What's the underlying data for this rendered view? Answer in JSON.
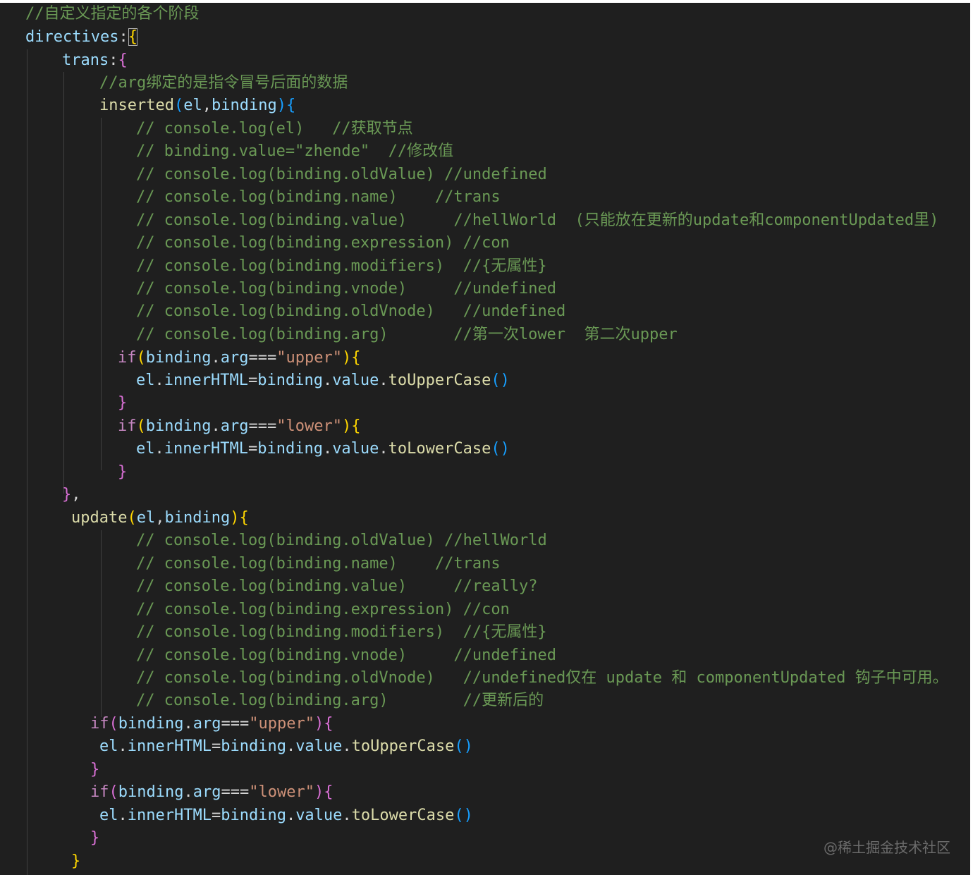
{
  "editor": {
    "lines": [
      [
        {
          "t": "//自定义指定的各个阶段",
          "c": "comment"
        }
      ],
      [
        {
          "t": "directives",
          "c": "prop"
        },
        {
          "t": ":",
          "c": "plain"
        },
        {
          "t": "{",
          "c": "p1",
          "box": true
        }
      ],
      [
        {
          "t": "trans",
          "c": "prop"
        },
        {
          "t": ":",
          "c": "plain"
        },
        {
          "t": "{",
          "c": "p2"
        }
      ],
      [
        {
          "t": "//arg绑定的是指令冒号后面的数据",
          "c": "comment"
        }
      ],
      [
        {
          "t": "inserted",
          "c": "fn"
        },
        {
          "t": "(",
          "c": "p3"
        },
        {
          "t": "el",
          "c": "prop"
        },
        {
          "t": ",",
          "c": "plain"
        },
        {
          "t": "binding",
          "c": "prop"
        },
        {
          "t": ")",
          "c": "p3"
        },
        {
          "t": "{",
          "c": "p3"
        }
      ],
      [
        {
          "t": "// console.log(el)   //获取节点",
          "c": "comment"
        }
      ],
      [
        {
          "t": "// binding.value=\"zhende\"  //修改值",
          "c": "comment"
        }
      ],
      [
        {
          "t": "// console.log(binding.oldValue) //undefined",
          "c": "comment"
        }
      ],
      [
        {
          "t": "// console.log(binding.name)    //trans",
          "c": "comment"
        }
      ],
      [
        {
          "t": "// console.log(binding.value)     //hellWorld  (只能放在更新的update和componentUpdated里)",
          "c": "comment"
        }
      ],
      [
        {
          "t": "// console.log(binding.expression) //con",
          "c": "comment"
        }
      ],
      [
        {
          "t": "// console.log(binding.modifiers)  //{无属性}",
          "c": "comment"
        }
      ],
      [
        {
          "t": "// console.log(binding.vnode)     //undefined",
          "c": "comment"
        }
      ],
      [
        {
          "t": "// console.log(binding.oldVnode)   //undefined",
          "c": "comment"
        }
      ],
      [
        {
          "t": "// console.log(binding.arg)       //第一次lower  第二次upper",
          "c": "comment"
        }
      ],
      [
        {
          "t": "if",
          "c": "kw"
        },
        {
          "t": "(",
          "c": "p1"
        },
        {
          "t": "binding",
          "c": "prop"
        },
        {
          "t": ".",
          "c": "plain"
        },
        {
          "t": "arg",
          "c": "prop"
        },
        {
          "t": "===",
          "c": "plain"
        },
        {
          "t": "\"upper\"",
          "c": "str"
        },
        {
          "t": ")",
          "c": "p1"
        },
        {
          "t": "{",
          "c": "p1"
        }
      ],
      [
        {
          "t": "el",
          "c": "prop"
        },
        {
          "t": ".",
          "c": "plain"
        },
        {
          "t": "innerHTML",
          "c": "prop"
        },
        {
          "t": "=",
          "c": "plain"
        },
        {
          "t": "binding",
          "c": "prop"
        },
        {
          "t": ".",
          "c": "plain"
        },
        {
          "t": "value",
          "c": "prop"
        },
        {
          "t": ".",
          "c": "plain"
        },
        {
          "t": "toUpperCase",
          "c": "fn"
        },
        {
          "t": "()",
          "c": "p3"
        }
      ],
      [
        {
          "t": "}",
          "c": "p2"
        }
      ],
      [
        {
          "t": "if",
          "c": "kw"
        },
        {
          "t": "(",
          "c": "p1"
        },
        {
          "t": "binding",
          "c": "prop"
        },
        {
          "t": ".",
          "c": "plain"
        },
        {
          "t": "arg",
          "c": "prop"
        },
        {
          "t": "===",
          "c": "plain"
        },
        {
          "t": "\"lower\"",
          "c": "str"
        },
        {
          "t": ")",
          "c": "p1"
        },
        {
          "t": "{",
          "c": "p1"
        }
      ],
      [
        {
          "t": "el",
          "c": "prop"
        },
        {
          "t": ".",
          "c": "plain"
        },
        {
          "t": "innerHTML",
          "c": "prop"
        },
        {
          "t": "=",
          "c": "plain"
        },
        {
          "t": "binding",
          "c": "prop"
        },
        {
          "t": ".",
          "c": "plain"
        },
        {
          "t": "value",
          "c": "prop"
        },
        {
          "t": ".",
          "c": "plain"
        },
        {
          "t": "toLowerCase",
          "c": "fn"
        },
        {
          "t": "()",
          "c": "p3"
        }
      ],
      [
        {
          "t": "}",
          "c": "p2"
        }
      ],
      [
        {
          "t": "}",
          "c": "p2"
        },
        {
          "t": ",",
          "c": "plain"
        }
      ],
      [
        {
          "t": "update",
          "c": "fn"
        },
        {
          "t": "(",
          "c": "p1"
        },
        {
          "t": "el",
          "c": "prop"
        },
        {
          "t": ",",
          "c": "plain"
        },
        {
          "t": "binding",
          "c": "prop"
        },
        {
          "t": ")",
          "c": "p1"
        },
        {
          "t": "{",
          "c": "p1"
        }
      ],
      [
        {
          "t": "// console.log(binding.oldValue) //hellWorld",
          "c": "comment"
        }
      ],
      [
        {
          "t": "// console.log(binding.name)    //trans",
          "c": "comment"
        }
      ],
      [
        {
          "t": "// console.log(binding.value)     //really?",
          "c": "comment"
        }
      ],
      [
        {
          "t": "// console.log(binding.expression) //con",
          "c": "comment"
        }
      ],
      [
        {
          "t": "// console.log(binding.modifiers)  //{无属性}",
          "c": "comment"
        }
      ],
      [
        {
          "t": "// console.log(binding.vnode)     //undefined",
          "c": "comment"
        }
      ],
      [
        {
          "t": "// console.log(binding.oldVnode)   //undefined仅在 update 和 componentUpdated 钩子中可用。",
          "c": "comment"
        }
      ],
      [
        {
          "t": "// console.log(binding.arg)        //更新后的",
          "c": "comment"
        }
      ],
      [
        {
          "t": "if",
          "c": "kw"
        },
        {
          "t": "(",
          "c": "p2"
        },
        {
          "t": "binding",
          "c": "prop"
        },
        {
          "t": ".",
          "c": "plain"
        },
        {
          "t": "arg",
          "c": "prop"
        },
        {
          "t": "===",
          "c": "plain"
        },
        {
          "t": "\"upper\"",
          "c": "str"
        },
        {
          "t": ")",
          "c": "p2"
        },
        {
          "t": "{",
          "c": "p2"
        }
      ],
      [
        {
          "t": "el",
          "c": "prop"
        },
        {
          "t": ".",
          "c": "plain"
        },
        {
          "t": "innerHTML",
          "c": "prop"
        },
        {
          "t": "=",
          "c": "plain"
        },
        {
          "t": "binding",
          "c": "prop"
        },
        {
          "t": ".",
          "c": "plain"
        },
        {
          "t": "value",
          "c": "prop"
        },
        {
          "t": ".",
          "c": "plain"
        },
        {
          "t": "toUpperCase",
          "c": "fn"
        },
        {
          "t": "()",
          "c": "p3"
        }
      ],
      [
        {
          "t": "}",
          "c": "p2"
        }
      ],
      [
        {
          "t": "if",
          "c": "kw"
        },
        {
          "t": "(",
          "c": "p2"
        },
        {
          "t": "binding",
          "c": "prop"
        },
        {
          "t": ".",
          "c": "plain"
        },
        {
          "t": "arg",
          "c": "prop"
        },
        {
          "t": "===",
          "c": "plain"
        },
        {
          "t": "\"lower\"",
          "c": "str"
        },
        {
          "t": ")",
          "c": "p2"
        },
        {
          "t": "{",
          "c": "p2"
        }
      ],
      [
        {
          "t": "el",
          "c": "prop"
        },
        {
          "t": ".",
          "c": "plain"
        },
        {
          "t": "innerHTML",
          "c": "prop"
        },
        {
          "t": "=",
          "c": "plain"
        },
        {
          "t": "binding",
          "c": "prop"
        },
        {
          "t": ".",
          "c": "plain"
        },
        {
          "t": "value",
          "c": "prop"
        },
        {
          "t": ".",
          "c": "plain"
        },
        {
          "t": "toLowerCase",
          "c": "fn"
        },
        {
          "t": "()",
          "c": "p3"
        }
      ],
      [
        {
          "t": "}",
          "c": "p2"
        }
      ],
      [
        {
          "t": "}",
          "c": "p1"
        }
      ]
    ]
  },
  "watermark": "@稀土掘金技术社区",
  "colors": {
    "background": "#1f1f1f",
    "comment": "#6a9955",
    "keyword": "#c586c0",
    "property": "#9cdcfe",
    "function": "#dcdcaa",
    "string": "#ce9178",
    "bracket_gold": "#ffd700",
    "bracket_orchid": "#da70d6",
    "bracket_blue": "#179fff"
  }
}
